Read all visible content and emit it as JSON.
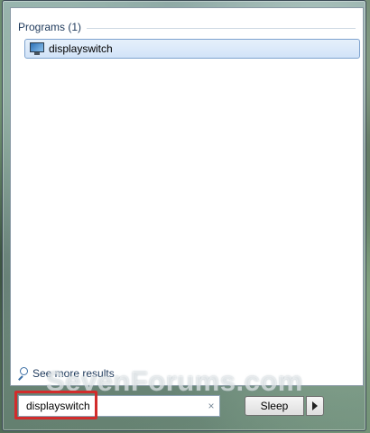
{
  "results": {
    "group_header": "Programs (1)",
    "items": [
      {
        "label": "displayswitch",
        "icon": "monitor-icon"
      }
    ],
    "see_more": "See more results"
  },
  "search": {
    "value": "displayswitch",
    "clear_glyph": "×"
  },
  "power": {
    "sleep_label": "Sleep",
    "options_icon": "right-arrow-icon"
  },
  "watermark": "SevenForums.com",
  "colors": {
    "highlight": "#d22c2c",
    "selection": "#d1e3f8"
  }
}
